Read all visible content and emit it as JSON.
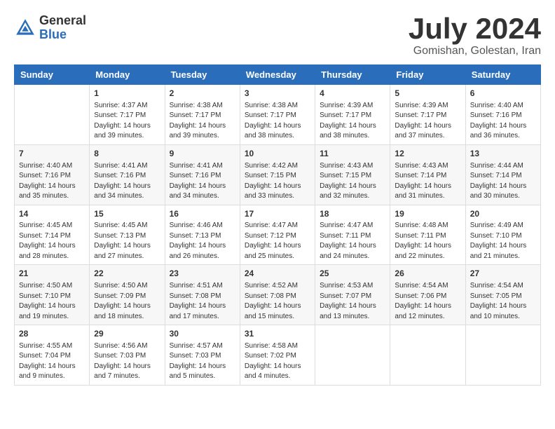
{
  "header": {
    "logo_general": "General",
    "logo_blue": "Blue",
    "month_title": "July 2024",
    "subtitle": "Gomishan, Golestan, Iran"
  },
  "calendar": {
    "days_of_week": [
      "Sunday",
      "Monday",
      "Tuesday",
      "Wednesday",
      "Thursday",
      "Friday",
      "Saturday"
    ],
    "weeks": [
      [
        {
          "day": "",
          "info": ""
        },
        {
          "day": "1",
          "info": "Sunrise: 4:37 AM\nSunset: 7:17 PM\nDaylight: 14 hours\nand 39 minutes."
        },
        {
          "day": "2",
          "info": "Sunrise: 4:38 AM\nSunset: 7:17 PM\nDaylight: 14 hours\nand 39 minutes."
        },
        {
          "day": "3",
          "info": "Sunrise: 4:38 AM\nSunset: 7:17 PM\nDaylight: 14 hours\nand 38 minutes."
        },
        {
          "day": "4",
          "info": "Sunrise: 4:39 AM\nSunset: 7:17 PM\nDaylight: 14 hours\nand 38 minutes."
        },
        {
          "day": "5",
          "info": "Sunrise: 4:39 AM\nSunset: 7:17 PM\nDaylight: 14 hours\nand 37 minutes."
        },
        {
          "day": "6",
          "info": "Sunrise: 4:40 AM\nSunset: 7:16 PM\nDaylight: 14 hours\nand 36 minutes."
        }
      ],
      [
        {
          "day": "7",
          "info": "Sunrise: 4:40 AM\nSunset: 7:16 PM\nDaylight: 14 hours\nand 35 minutes."
        },
        {
          "day": "8",
          "info": "Sunrise: 4:41 AM\nSunset: 7:16 PM\nDaylight: 14 hours\nand 34 minutes."
        },
        {
          "day": "9",
          "info": "Sunrise: 4:41 AM\nSunset: 7:16 PM\nDaylight: 14 hours\nand 34 minutes."
        },
        {
          "day": "10",
          "info": "Sunrise: 4:42 AM\nSunset: 7:15 PM\nDaylight: 14 hours\nand 33 minutes."
        },
        {
          "day": "11",
          "info": "Sunrise: 4:43 AM\nSunset: 7:15 PM\nDaylight: 14 hours\nand 32 minutes."
        },
        {
          "day": "12",
          "info": "Sunrise: 4:43 AM\nSunset: 7:14 PM\nDaylight: 14 hours\nand 31 minutes."
        },
        {
          "day": "13",
          "info": "Sunrise: 4:44 AM\nSunset: 7:14 PM\nDaylight: 14 hours\nand 30 minutes."
        }
      ],
      [
        {
          "day": "14",
          "info": "Sunrise: 4:45 AM\nSunset: 7:14 PM\nDaylight: 14 hours\nand 28 minutes."
        },
        {
          "day": "15",
          "info": "Sunrise: 4:45 AM\nSunset: 7:13 PM\nDaylight: 14 hours\nand 27 minutes."
        },
        {
          "day": "16",
          "info": "Sunrise: 4:46 AM\nSunset: 7:13 PM\nDaylight: 14 hours\nand 26 minutes."
        },
        {
          "day": "17",
          "info": "Sunrise: 4:47 AM\nSunset: 7:12 PM\nDaylight: 14 hours\nand 25 minutes."
        },
        {
          "day": "18",
          "info": "Sunrise: 4:47 AM\nSunset: 7:11 PM\nDaylight: 14 hours\nand 24 minutes."
        },
        {
          "day": "19",
          "info": "Sunrise: 4:48 AM\nSunset: 7:11 PM\nDaylight: 14 hours\nand 22 minutes."
        },
        {
          "day": "20",
          "info": "Sunrise: 4:49 AM\nSunset: 7:10 PM\nDaylight: 14 hours\nand 21 minutes."
        }
      ],
      [
        {
          "day": "21",
          "info": "Sunrise: 4:50 AM\nSunset: 7:10 PM\nDaylight: 14 hours\nand 19 minutes."
        },
        {
          "day": "22",
          "info": "Sunrise: 4:50 AM\nSunset: 7:09 PM\nDaylight: 14 hours\nand 18 minutes."
        },
        {
          "day": "23",
          "info": "Sunrise: 4:51 AM\nSunset: 7:08 PM\nDaylight: 14 hours\nand 17 minutes."
        },
        {
          "day": "24",
          "info": "Sunrise: 4:52 AM\nSunset: 7:08 PM\nDaylight: 14 hours\nand 15 minutes."
        },
        {
          "day": "25",
          "info": "Sunrise: 4:53 AM\nSunset: 7:07 PM\nDaylight: 14 hours\nand 13 minutes."
        },
        {
          "day": "26",
          "info": "Sunrise: 4:54 AM\nSunset: 7:06 PM\nDaylight: 14 hours\nand 12 minutes."
        },
        {
          "day": "27",
          "info": "Sunrise: 4:54 AM\nSunset: 7:05 PM\nDaylight: 14 hours\nand 10 minutes."
        }
      ],
      [
        {
          "day": "28",
          "info": "Sunrise: 4:55 AM\nSunset: 7:04 PM\nDaylight: 14 hours\nand 9 minutes."
        },
        {
          "day": "29",
          "info": "Sunrise: 4:56 AM\nSunset: 7:03 PM\nDaylight: 14 hours\nand 7 minutes."
        },
        {
          "day": "30",
          "info": "Sunrise: 4:57 AM\nSunset: 7:03 PM\nDaylight: 14 hours\nand 5 minutes."
        },
        {
          "day": "31",
          "info": "Sunrise: 4:58 AM\nSunset: 7:02 PM\nDaylight: 14 hours\nand 4 minutes."
        },
        {
          "day": "",
          "info": ""
        },
        {
          "day": "",
          "info": ""
        },
        {
          "day": "",
          "info": ""
        }
      ]
    ]
  }
}
